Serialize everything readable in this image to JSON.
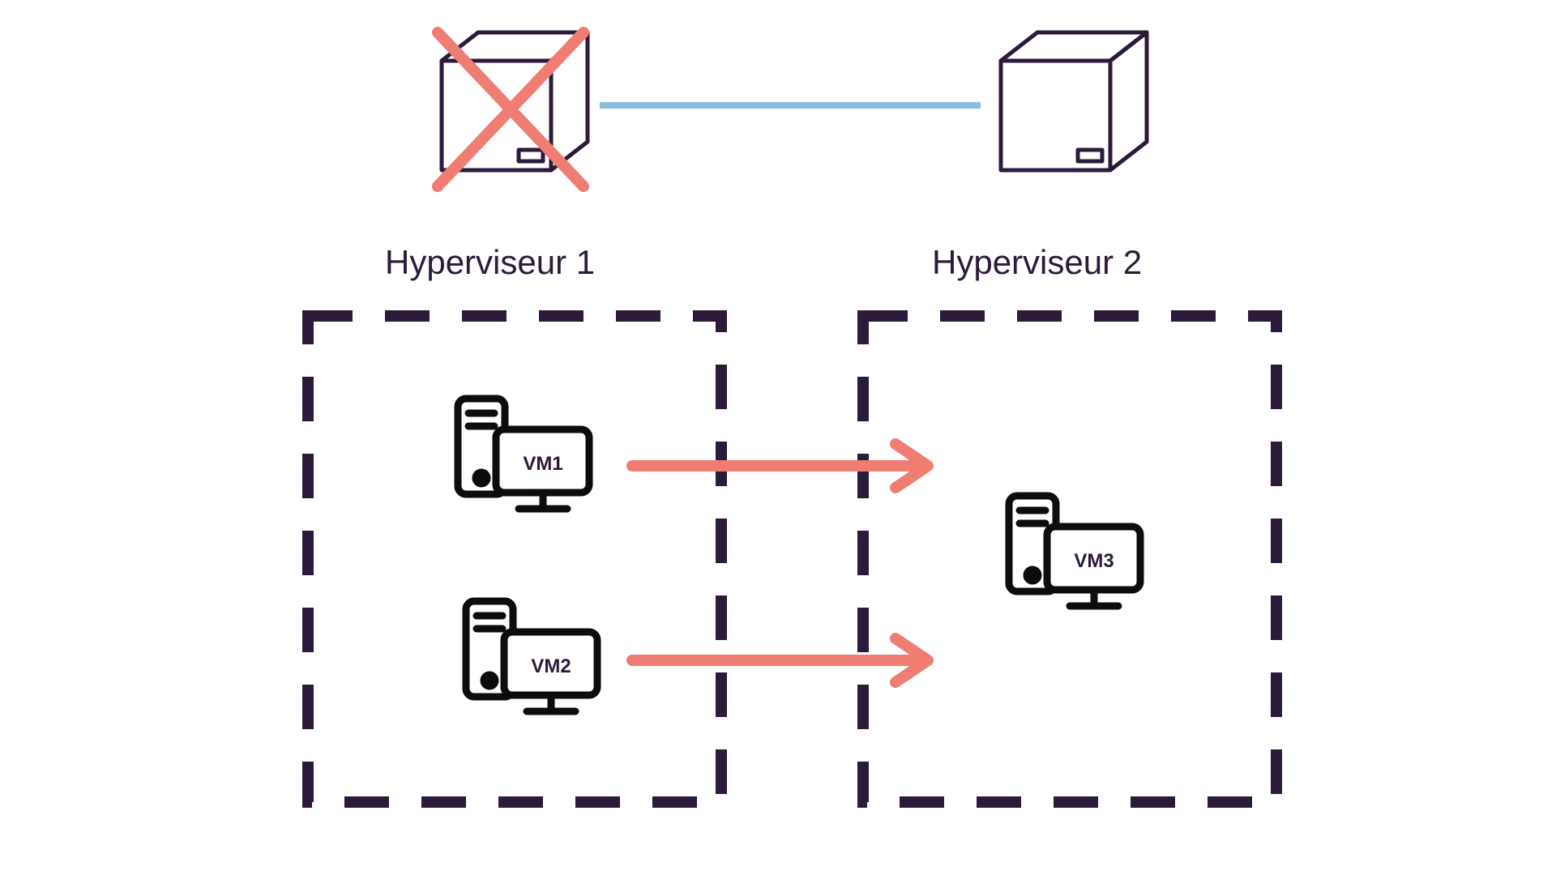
{
  "colors": {
    "dark": "#2c1a3a",
    "coral": "#ef7d72",
    "blue": "#8bbde0",
    "black": "#0c0c0c"
  },
  "hypervisors": {
    "left": {
      "label": "Hyperviseur 1",
      "failed": true
    },
    "right": {
      "label": "Hyperviseur 2",
      "failed": false
    }
  },
  "vms": {
    "vm1": {
      "label": "VM1",
      "migrating": true
    },
    "vm2": {
      "label": "VM2",
      "migrating": true
    },
    "vm3": {
      "label": "VM3",
      "migrating": false
    }
  }
}
